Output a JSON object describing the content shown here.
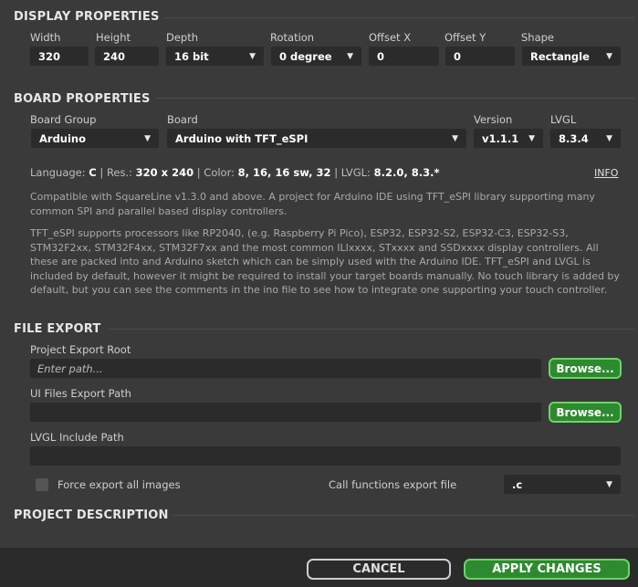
{
  "display": {
    "title": "DISPLAY PROPERTIES",
    "width_label": "Width",
    "width_value": "320",
    "height_label": "Height",
    "height_value": "240",
    "depth_label": "Depth",
    "depth_value": "16 bit",
    "rotation_label": "Rotation",
    "rotation_value": "0 degree",
    "offset_x_label": "Offset X",
    "offset_x_value": "0",
    "offset_y_label": "Offset Y",
    "offset_y_value": "0",
    "shape_label": "Shape",
    "shape_value": "Rectangle"
  },
  "board": {
    "title": "BOARD PROPERTIES",
    "group_label": "Board Group",
    "group_value": "Arduino",
    "board_label": "Board",
    "board_value": "Arduino with TFT_eSPI",
    "version_label": "Version",
    "version_value": "v1.1.1",
    "lvgl_label": "LVGL",
    "lvgl_value": "8.3.4",
    "info": {
      "language_label": "Language:",
      "language_value": "C",
      "res_label": "Res.:",
      "res_value": "320 x 240",
      "color_label": "Color:",
      "color_value": "8, 16, 16 sw, 32",
      "lvgl_label": "LVGL:",
      "lvgl_value": "8.2.0, 8.3.*",
      "sep": "|"
    },
    "info_link": "INFO",
    "description1": "Compatible with SquareLine v1.3.0 and above. A project for Arduino IDE using TFT_eSPI library supporting many common SPI and parallel based display controllers.",
    "description2": "TFT_eSPI supports processors like RP2040, (e.g. Raspberry Pi Pico), ESP32, ESP32-S2, ESP32-C3, ESP32-S3, STM32F2xx, STM32F4xx, STM32F7xx and the most common ILIxxxx, STxxxx and SSDxxxx display controllers. All these are packed into and Arduino sketch which can be simply used with the Arduino IDE. TFT_eSPI and LVGL is included by default, however it might be required to install your target boards manually.  No touch library is added by default, but you can see the comments in the ino file to see how to integrate one supporting your touch controller."
  },
  "export": {
    "title": "FILE EXPORT",
    "root_label": "Project Export Root",
    "root_placeholder": "Enter path...",
    "root_value": "",
    "browse_label": "Browse...",
    "ui_label": "UI Files Export Path",
    "ui_value": "",
    "lvgl_include_label": "LVGL Include Path",
    "lvgl_include_value": "",
    "force_export_label": "Force export all images",
    "force_export_checked": false,
    "call_functions_label": "Call functions export file",
    "call_functions_value": ".c"
  },
  "project": {
    "title": "PROJECT DESCRIPTION"
  },
  "footer": {
    "cancel_label": "CANCEL",
    "apply_label": "APPLY CHANGES"
  },
  "colors": {
    "panel": "#3a3a3a",
    "field": "#2b2b2b",
    "accent_green": "#2d8a2f",
    "accent_green_border": "#6fd26a"
  }
}
